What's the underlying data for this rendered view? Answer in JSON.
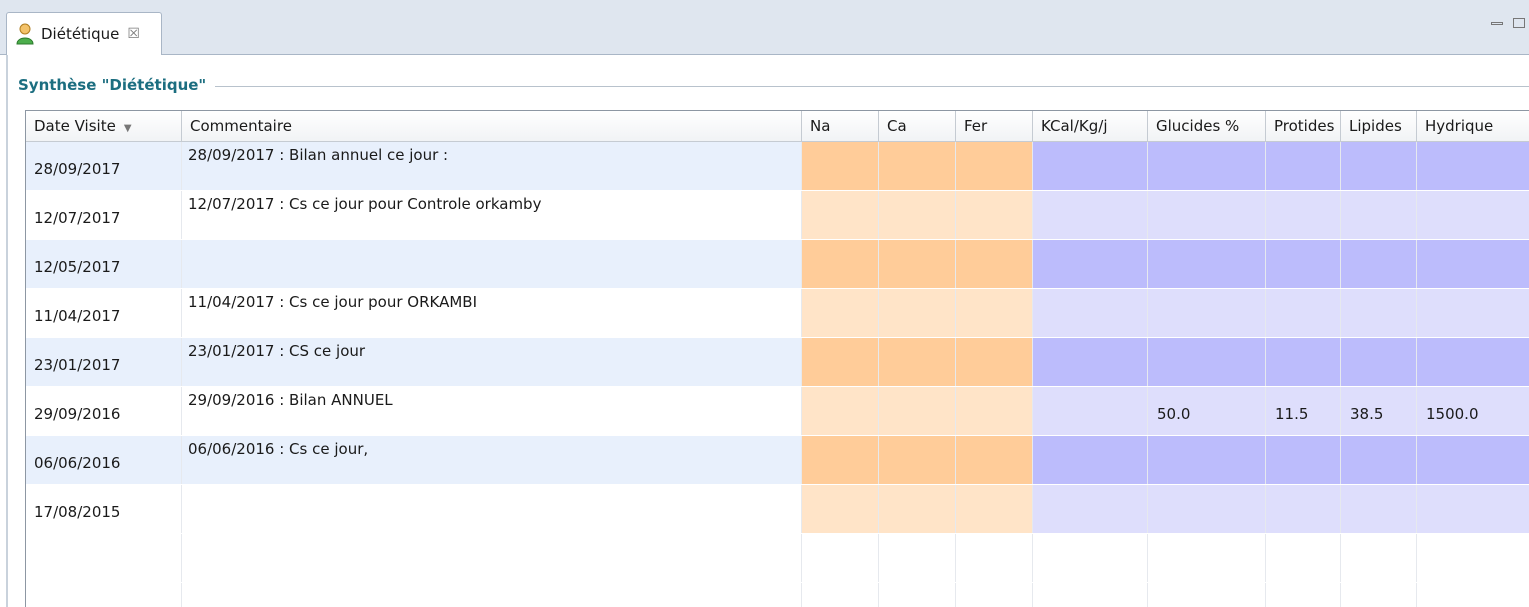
{
  "tab": {
    "label": "Diététique",
    "close_glyph": "☒"
  },
  "group_title": "Synthèse \"Diététique\"",
  "columns": [
    {
      "key": "date",
      "label": "Date Visite",
      "sort": "▼"
    },
    {
      "key": "comment",
      "label": "Commentaire"
    },
    {
      "key": "na",
      "label": "Na"
    },
    {
      "key": "ca",
      "label": "Ca"
    },
    {
      "key": "fer",
      "label": "Fer"
    },
    {
      "key": "kcal",
      "label": "KCal/Kg/j"
    },
    {
      "key": "glucides",
      "label": "Glucides %"
    },
    {
      "key": "protides",
      "label": "Protides"
    },
    {
      "key": "lipides",
      "label": "Lipides"
    },
    {
      "key": "hydrique",
      "label": "Hydrique"
    }
  ],
  "rows": [
    {
      "date": "28/09/2017",
      "comment": "28/09/2017 : Bilan annuel ce jour :",
      "na": "",
      "ca": "",
      "fer": "",
      "kcal": "",
      "glucides": "",
      "protides": "",
      "lipides": "",
      "hydrique": ""
    },
    {
      "date": "12/07/2017",
      "comment": "12/07/2017 : Cs ce jour pour Controle orkamby",
      "na": "",
      "ca": "",
      "fer": "",
      "kcal": "",
      "glucides": "",
      "protides": "",
      "lipides": "",
      "hydrique": ""
    },
    {
      "date": "12/05/2017",
      "comment": "",
      "na": "",
      "ca": "",
      "fer": "",
      "kcal": "",
      "glucides": "",
      "protides": "",
      "lipides": "",
      "hydrique": ""
    },
    {
      "date": "11/04/2017",
      "comment": "11/04/2017 : Cs ce jour pour ORKAMBI",
      "na": "",
      "ca": "",
      "fer": "",
      "kcal": "",
      "glucides": "",
      "protides": "",
      "lipides": "",
      "hydrique": ""
    },
    {
      "date": "23/01/2017",
      "comment": "23/01/2017 : CS ce jour",
      "na": "",
      "ca": "",
      "fer": "",
      "kcal": "",
      "glucides": "",
      "protides": "",
      "lipides": "",
      "hydrique": ""
    },
    {
      "date": "29/09/2016",
      "comment": "29/09/2016 : Bilan ANNUEL",
      "na": "",
      "ca": "",
      "fer": "",
      "kcal": "",
      "glucides": "50.0",
      "protides": "11.5",
      "lipides": "38.5",
      "hydrique": "1500.0"
    },
    {
      "date": "06/06/2016",
      "comment": "06/06/2016 : Cs ce jour,",
      "na": "",
      "ca": "",
      "fer": "",
      "kcal": "",
      "glucides": "",
      "protides": "",
      "lipides": "",
      "hydrique": ""
    },
    {
      "date": "17/08/2015",
      "comment": "",
      "na": "",
      "ca": "",
      "fer": "",
      "kcal": "",
      "glucides": "",
      "protides": "",
      "lipides": "",
      "hydrique": ""
    }
  ],
  "colors": {
    "row_alt": "#e8f0fc",
    "row_plain": "#ffffff",
    "mineral_dark": "#ffcc99",
    "mineral_light": "#ffe4c8",
    "nutrient_dark": "#bcbcfc",
    "nutrient_light": "#dedefc",
    "title": "#1c6e80"
  }
}
